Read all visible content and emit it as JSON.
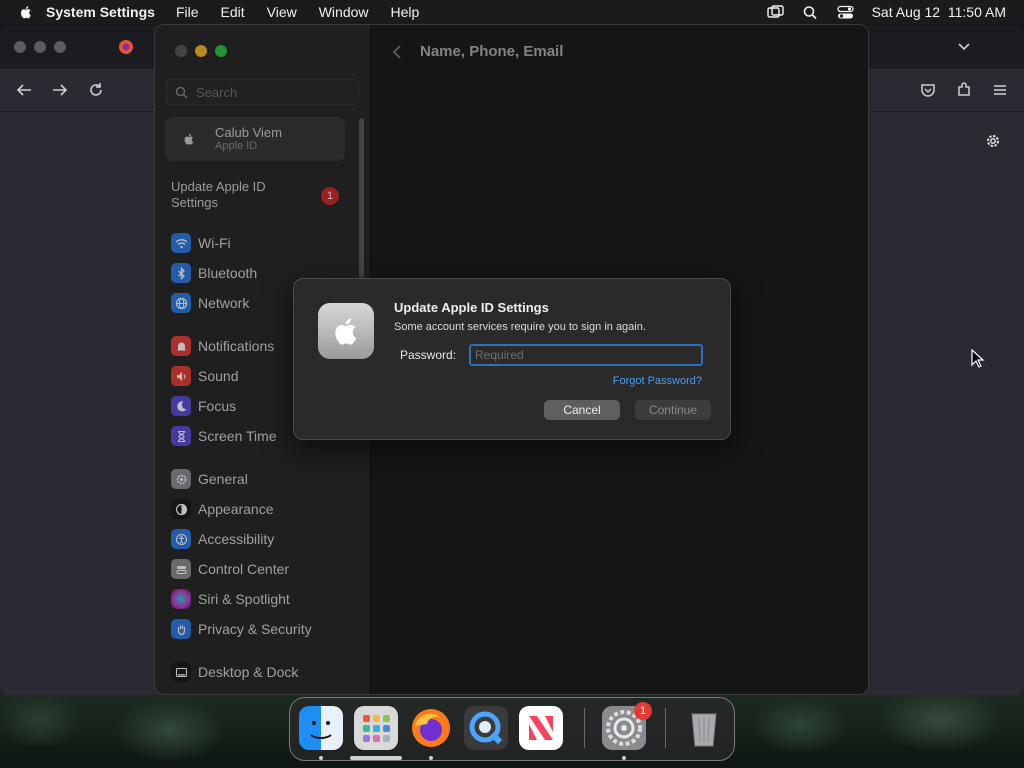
{
  "menubar": {
    "app_name": "System Settings",
    "items": [
      "File",
      "Edit",
      "View",
      "Window",
      "Help"
    ],
    "datetime": "Sat Aug 12  11:50 AM"
  },
  "settings": {
    "search_placeholder": "Search",
    "account": {
      "name": "Calub Viem",
      "subtitle": "Apple ID"
    },
    "update": {
      "label": "Update Apple ID Settings",
      "badge": "1"
    },
    "page_title": "Name, Phone, Email",
    "sidebar_items": [
      {
        "label": "Wi-Fi",
        "icon": "wifi-icon",
        "color": "#2f7de1"
      },
      {
        "label": "Bluetooth",
        "icon": "bluetooth-icon",
        "color": "#2f7de1"
      },
      {
        "label": "Network",
        "icon": "globe-icon",
        "color": "#2f7de1"
      },
      {
        "label": "Notifications",
        "icon": "bell-icon",
        "color": "#e5413a"
      },
      {
        "label": "Sound",
        "icon": "speaker-icon",
        "color": "#e5413a"
      },
      {
        "label": "Focus",
        "icon": "moon-icon",
        "color": "#5b4fd6"
      },
      {
        "label": "Screen Time",
        "icon": "hourglass-icon",
        "color": "#5b4fd6"
      },
      {
        "label": "General",
        "icon": "gear-icon",
        "color": "#8e8e93"
      },
      {
        "label": "Appearance",
        "icon": "appearance-icon",
        "color": "#1c1c1c"
      },
      {
        "label": "Accessibility",
        "icon": "accessibility-icon",
        "color": "#2f7de1"
      },
      {
        "label": "Control Center",
        "icon": "control-center-icon",
        "color": "#8e8e93"
      },
      {
        "label": "Siri & Spotlight",
        "icon": "siri-icon",
        "color": "#c13cc7"
      },
      {
        "label": "Privacy & Security",
        "icon": "hand-icon",
        "color": "#2f7de1"
      },
      {
        "label": "Desktop & Dock",
        "icon": "dock-icon",
        "color": "#1c1c1c"
      }
    ]
  },
  "dialog": {
    "title": "Update Apple ID Settings",
    "message": "Some account services require you to sign in again.",
    "password_label": "Password:",
    "password_placeholder": "Required",
    "forgot_link": "Forgot Password?",
    "cancel_label": "Cancel",
    "continue_label": "Continue"
  },
  "dock": {
    "apps": [
      "finder-icon",
      "launchpad-icon",
      "firefox-icon",
      "quicktime-icon",
      "news-icon",
      "system-settings-icon",
      "trash-icon"
    ],
    "settings_badge": "1"
  }
}
